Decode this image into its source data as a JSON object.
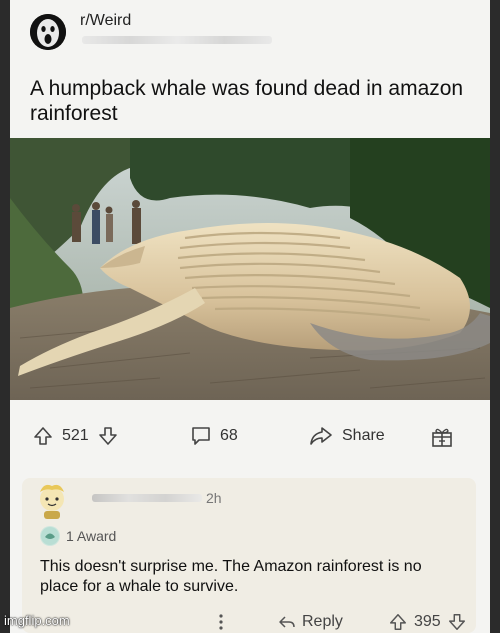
{
  "post": {
    "subreddit": "r/Weird",
    "title": "A humpback whale was found dead in amazon rainforest"
  },
  "actions": {
    "upvotes": "521",
    "comments": "68",
    "share_label": "Share"
  },
  "comment": {
    "time": "2h",
    "award": "1 Award",
    "text": "This doesn't surprise me. The Amazon rainforest is no place for a whale to survive.",
    "reply_label": "Reply",
    "votes": "395"
  },
  "watermark": "imgflip.com",
  "icons": {
    "upvote": "arrow-up-icon",
    "downvote": "arrow-down-icon",
    "comment": "comment-bubble-icon",
    "share": "share-arrow-icon",
    "award": "gift-award-icon",
    "more": "more-dots-icon",
    "reply": "reply-arrow-icon"
  }
}
